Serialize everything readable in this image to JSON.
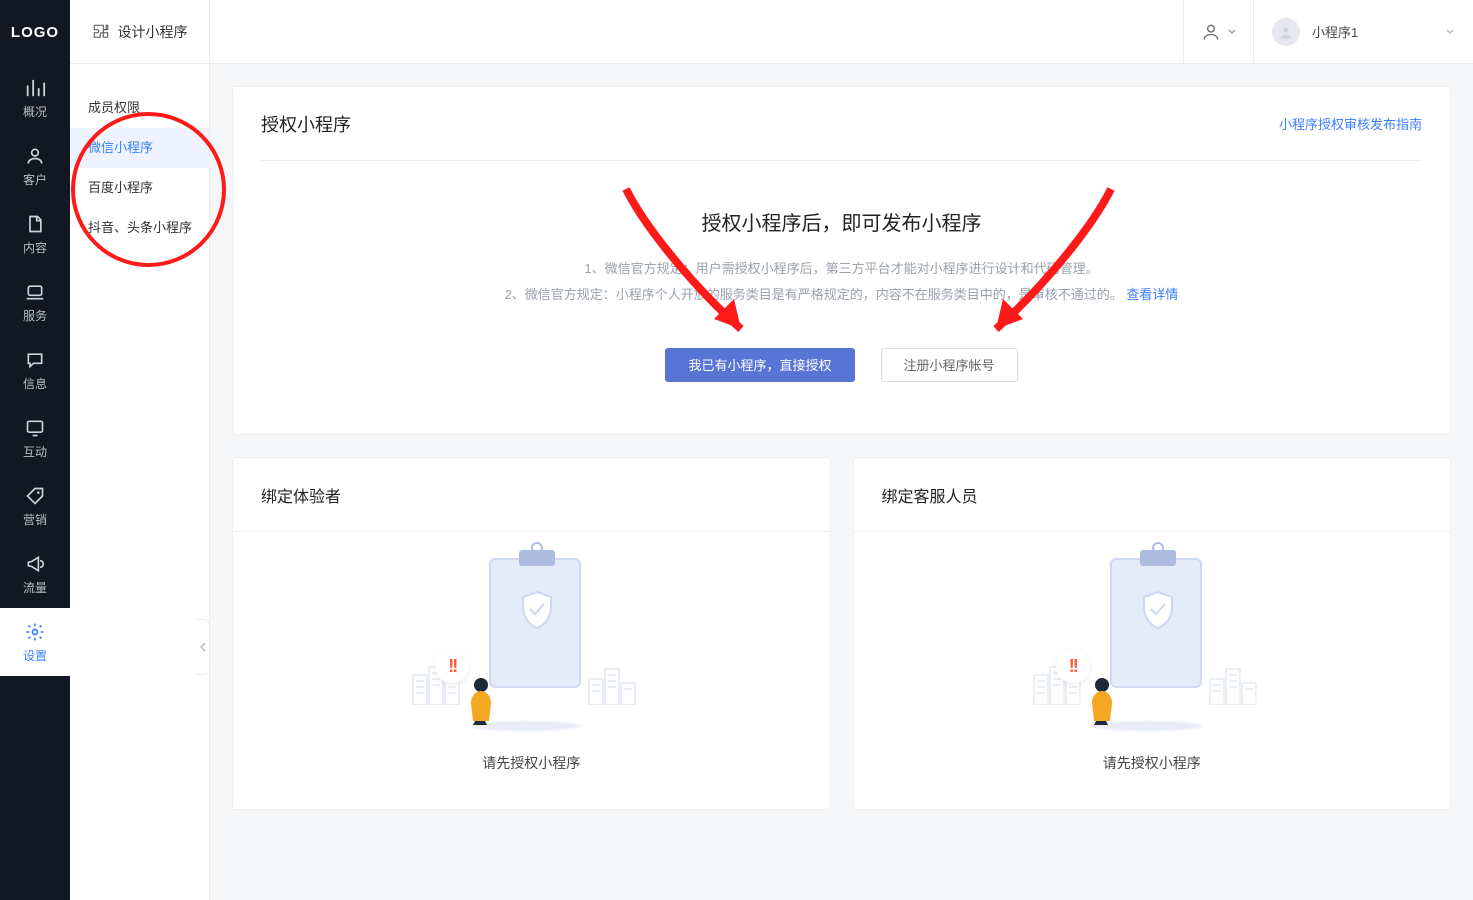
{
  "logo_text": "LOGO",
  "dark_nav": [
    {
      "label": "概况"
    },
    {
      "label": "客户"
    },
    {
      "label": "内容"
    },
    {
      "label": "服务"
    },
    {
      "label": "信息"
    },
    {
      "label": "互动"
    },
    {
      "label": "营销"
    },
    {
      "label": "流量"
    },
    {
      "label": "设置"
    }
  ],
  "top_design_label": "设计小程序",
  "top_app_name": "小程序1",
  "sub_nav": {
    "head": "成员权限",
    "items": [
      {
        "label": "微信小程序",
        "active": true
      },
      {
        "label": "百度小程序"
      },
      {
        "label": "抖音、头条小程序"
      }
    ]
  },
  "auth": {
    "title": "授权小程序",
    "link": "小程序授权审核发布指南",
    "tip": "授权小程序后，即可发布小程序",
    "rule1": "1、微信官方规定：用户需授权小程序后，第三方平台才能对小程序进行设计和代码管理。",
    "rule2_a": "2、微信官方规定：小程序个人开放的服务类目是有严格规定的，内容不在服务类目中的，是审核不通过的。",
    "see_detail": "查看详情",
    "btn_primary": "我已有小程序，直接授权",
    "btn_plain": "注册小程序帐号"
  },
  "bind_tester": {
    "title": "绑定体验者",
    "empty": "请先授权小程序"
  },
  "bind_cs": {
    "title": "绑定客服人员",
    "empty": "请先授权小程序"
  }
}
